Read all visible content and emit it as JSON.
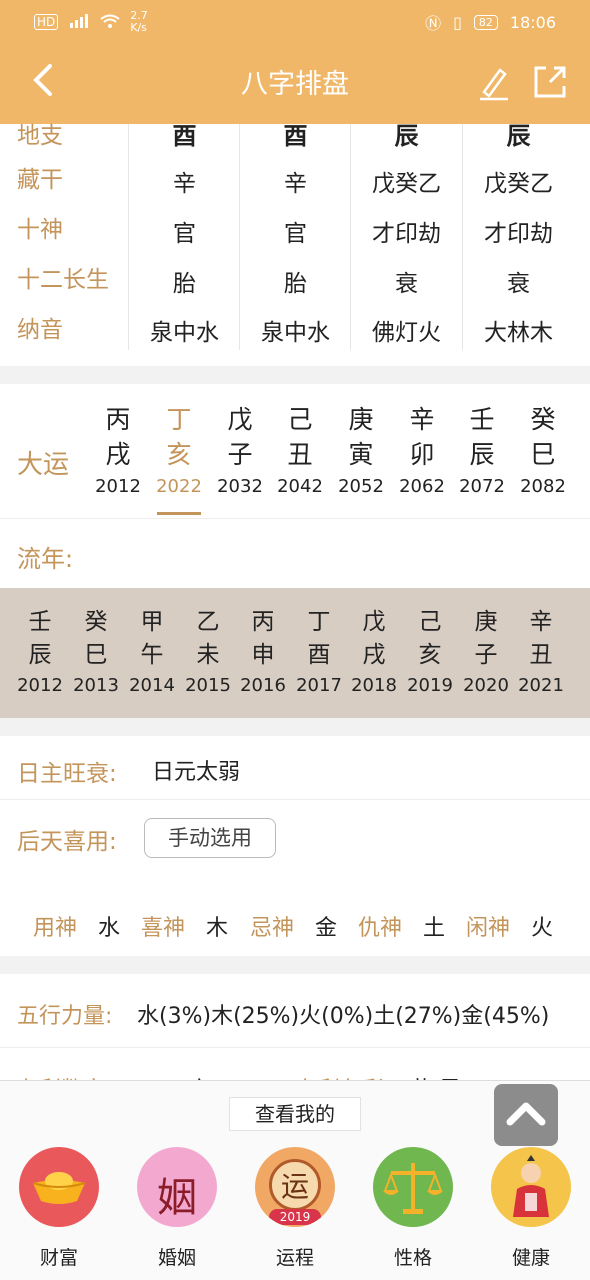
{
  "status_bar": {
    "net": "HD",
    "signal": "4G",
    "speed": "2.7\nK/s",
    "battery": "82",
    "time": "18:06"
  },
  "header": {
    "title": "八字排盘"
  },
  "pillar_table": {
    "labels": [
      "地支",
      "藏干",
      "十神",
      "十二长生",
      "纳音"
    ],
    "columns": [
      {
        "top": "酉",
        "canggan": "辛",
        "shishen": "官",
        "changsheng": "胎",
        "nayin": "泉中水"
      },
      {
        "top": "酉",
        "canggan": "辛",
        "shishen": "官",
        "changsheng": "胎",
        "nayin": "泉中水"
      },
      {
        "top": "辰",
        "canggan": "戊癸乙",
        "shishen": "才印劫",
        "changsheng": "衰",
        "nayin": "佛灯火"
      },
      {
        "top": "辰",
        "canggan": "戊癸乙",
        "shishen": "才印劫",
        "changsheng": "衰",
        "nayin": "大林木"
      }
    ]
  },
  "dayun": {
    "label": "大运",
    "items": [
      {
        "g1": "丙",
        "g2": "戌",
        "year": "2012"
      },
      {
        "g1": "丁",
        "g2": "亥",
        "year": "2022"
      },
      {
        "g1": "戊",
        "g2": "子",
        "year": "2032"
      },
      {
        "g1": "己",
        "g2": "丑",
        "year": "2042"
      },
      {
        "g1": "庚",
        "g2": "寅",
        "year": "2052"
      },
      {
        "g1": "辛",
        "g2": "卯",
        "year": "2062"
      },
      {
        "g1": "壬",
        "g2": "辰",
        "year": "2072"
      },
      {
        "g1": "癸",
        "g2": "巳",
        "year": "2082"
      }
    ],
    "active_index": 1
  },
  "liunian": {
    "label": "流年:",
    "items": [
      {
        "g1": "壬",
        "g2": "辰",
        "year": "2012"
      },
      {
        "g1": "癸",
        "g2": "巳",
        "year": "2013"
      },
      {
        "g1": "甲",
        "g2": "午",
        "year": "2014"
      },
      {
        "g1": "乙",
        "g2": "未",
        "year": "2015"
      },
      {
        "g1": "丙",
        "g2": "申",
        "year": "2016"
      },
      {
        "g1": "丁",
        "g2": "酉",
        "year": "2017"
      },
      {
        "g1": "戊",
        "g2": "戌",
        "year": "2018"
      },
      {
        "g1": "己",
        "g2": "亥",
        "year": "2019"
      },
      {
        "g1": "庚",
        "g2": "子",
        "year": "2020"
      },
      {
        "g1": "辛",
        "g2": "丑",
        "year": "2021"
      }
    ]
  },
  "analysis": {
    "wangshuai_label": "日主旺衰:",
    "wangshuai_value": "日元太弱",
    "xiyong_label": "后天喜用:",
    "select_button": "手动选用",
    "shen": [
      {
        "k": "用神",
        "v": "水"
      },
      {
        "k": "喜神",
        "v": "木"
      },
      {
        "k": "忌神",
        "v": "金"
      },
      {
        "k": "仇神",
        "v": "土"
      },
      {
        "k": "闲神",
        "v": "火"
      }
    ]
  },
  "wuxing": {
    "label": "五行力量:",
    "value": "水(3%)木(25%)火(0%)土(27%)金(45%)"
  },
  "partial_row": {
    "left_label": "有利数字",
    "left_value": "一 六",
    "right_label": "有利色彩",
    "right_value": "黄 黑"
  },
  "bottom_panel": {
    "title": "查看我的",
    "items": [
      {
        "label": "财富",
        "icon": "gold-ingot-icon"
      },
      {
        "label": "婚姻",
        "icon": "marriage-icon",
        "glyph": "姻"
      },
      {
        "label": "运程",
        "icon": "fortune-icon",
        "glyph": "运",
        "badge": "2019"
      },
      {
        "label": "性格",
        "icon": "scale-icon"
      },
      {
        "label": "健康",
        "icon": "health-icon"
      }
    ]
  },
  "colors": {
    "header": "#f1b768",
    "accent": "#c4955b",
    "liunian_bg": "#d8cdc3"
  }
}
